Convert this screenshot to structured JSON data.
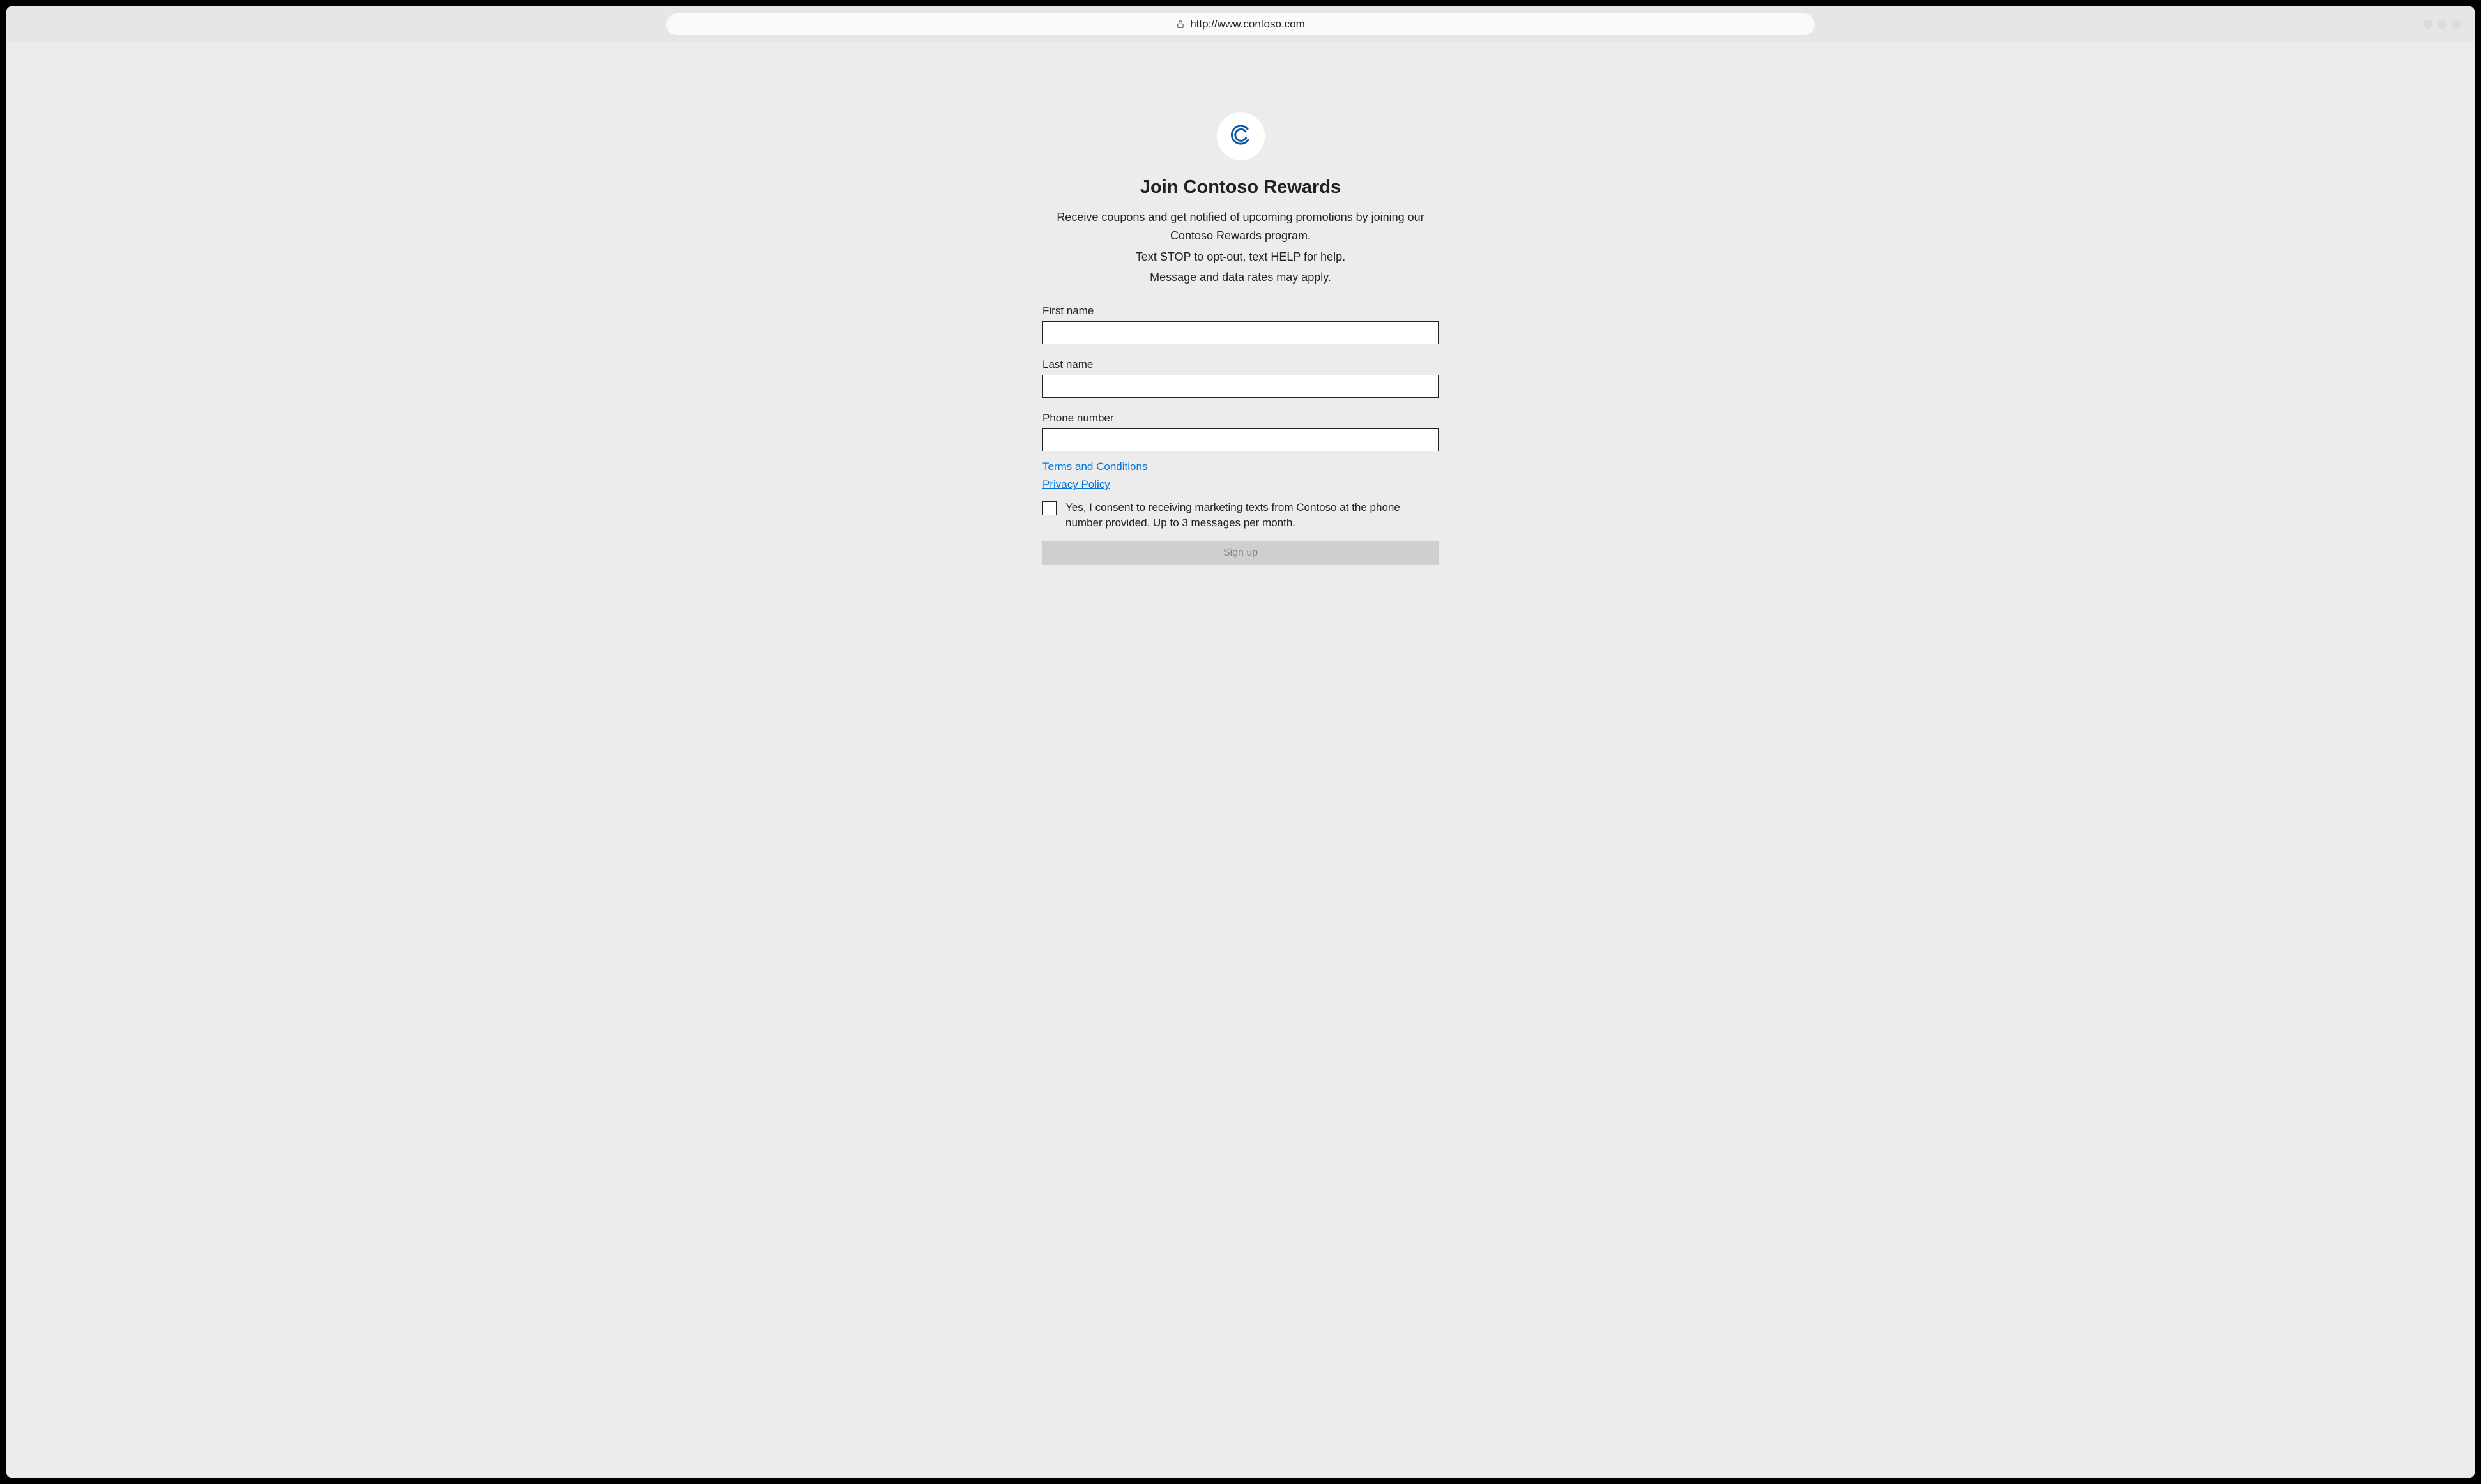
{
  "browser": {
    "url": "http://www.contoso.com"
  },
  "logo": {
    "letter": "C"
  },
  "header": {
    "title": "Join Contoso Rewards",
    "desc1": "Receive coupons and get notified of upcoming promotions by joining our Contoso Rewards program.",
    "desc2": "Text STOP to opt-out, text HELP for help.",
    "desc3": "Message and data rates may apply."
  },
  "form": {
    "first_name_label": "First name",
    "first_name_value": "",
    "last_name_label": "Last name",
    "last_name_value": "",
    "phone_label": "Phone number",
    "phone_value": "",
    "terms_link": "Terms and Conditions",
    "privacy_link": "Privacy Policy",
    "consent_text": "Yes, I consent to receiving marketing texts from Contoso at the phone number provided. Up to 3 messages per month.",
    "consent_checked": false,
    "signup_label": "Sign up"
  }
}
